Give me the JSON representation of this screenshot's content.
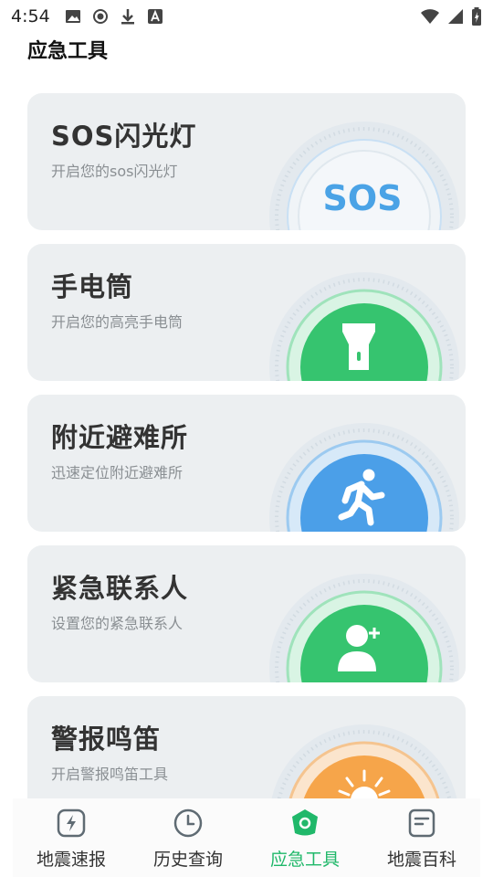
{
  "status_bar": {
    "time": "4:54",
    "left_icons": [
      "image-icon",
      "record-icon",
      "download-icon",
      "text-a-icon"
    ],
    "right_icons": [
      "wifi-icon",
      "signal-icon",
      "battery-icon"
    ]
  },
  "page": {
    "title": "应急工具"
  },
  "cards": [
    {
      "title": "SOS闪光灯",
      "subtitle": "开启您的sos闪光灯",
      "badge_text": "SOS",
      "icon": "sos-icon",
      "color": "#5aaee8"
    },
    {
      "title": "手电筒",
      "subtitle": "开启您的高亮手电筒",
      "icon": "flashlight-icon",
      "color": "#2ec46c"
    },
    {
      "title": "附近避难所",
      "subtitle": "迅速定位附近避难所",
      "icon": "running-person-icon",
      "color": "#3f9ae6"
    },
    {
      "title": "紧急联系人",
      "subtitle": "设置您的紧急联系人",
      "icon": "add-contact-icon",
      "color": "#2ec46c"
    },
    {
      "title": "警报鸣笛",
      "subtitle": "开启警报鸣笛工具",
      "icon": "siren-icon",
      "color": "#f5a340"
    }
  ],
  "bottom_nav": {
    "active_color": "#20b86a",
    "items": [
      {
        "label": "地震速报",
        "icon": "lightning-icon",
        "active": false
      },
      {
        "label": "历史查询",
        "icon": "clock-icon",
        "active": false
      },
      {
        "label": "应急工具",
        "icon": "shield-icon",
        "active": true
      },
      {
        "label": "地震百科",
        "icon": "book-icon",
        "active": false
      }
    ]
  }
}
